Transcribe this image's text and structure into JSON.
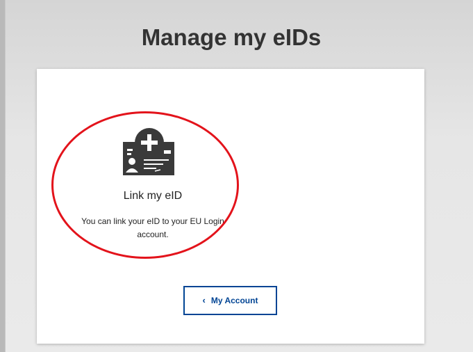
{
  "page": {
    "title": "Manage my eIDs"
  },
  "card": {
    "icon": "id-card-add-icon",
    "title": "Link my eID",
    "description": "You can link your eID to your EU Login account."
  },
  "navigation": {
    "back_label": "My Account",
    "back_icon": "chevron-left-icon"
  },
  "colors": {
    "primary": "#004494",
    "highlight": "#e3131b",
    "icon_dark": "#3a3a3a"
  }
}
